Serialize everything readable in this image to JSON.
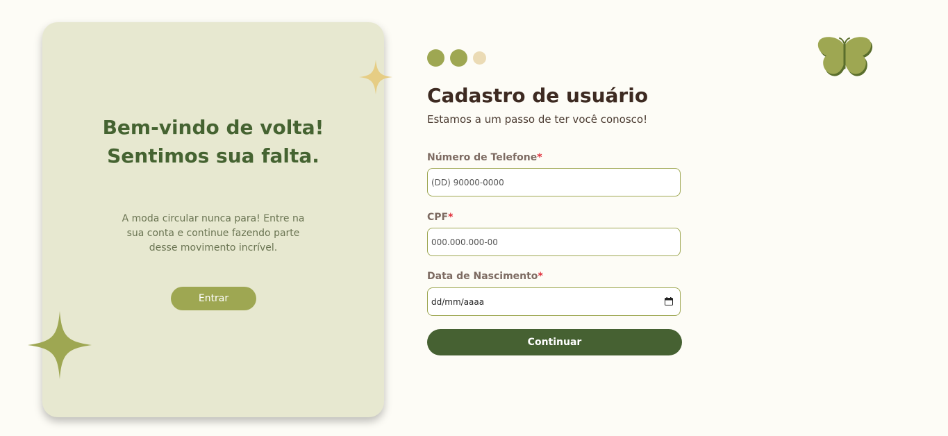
{
  "welcome": {
    "title": "Bem-vindo de volta! Sentimos sua falta.",
    "text": "A moda circular nunca para! Entre na sua conta e continue fazendo parte desse movimento incrível.",
    "enter_label": "Entrar"
  },
  "steps": {
    "total": 3,
    "completed": 2
  },
  "form": {
    "title": "Cadastro de usuário",
    "subtitle": "Estamos a um passo de ter você conosco!",
    "phone_label": "Número de Telefone",
    "phone_placeholder": "(DD) 90000-0000",
    "cpf_label": "CPF",
    "cpf_placeholder": "000.000.000-00",
    "birth_label": "Data de Nascimento",
    "birth_value": "dd/mm/aaaa",
    "required_mark": "*",
    "continue_label": "Continuar"
  },
  "icons": {
    "decor_sparkle": "sparkle-icon",
    "brand": "butterfly-icon",
    "date": "calendar-icon"
  },
  "colors": {
    "background": "#fdfcf6",
    "card": "#e7e8d0",
    "primary_dark": "#466132",
    "olive": "#9ea752",
    "sand": "#ebdbb5",
    "title_green": "#456331",
    "text_brown": "#3d2a21",
    "required": "#e0303c"
  }
}
